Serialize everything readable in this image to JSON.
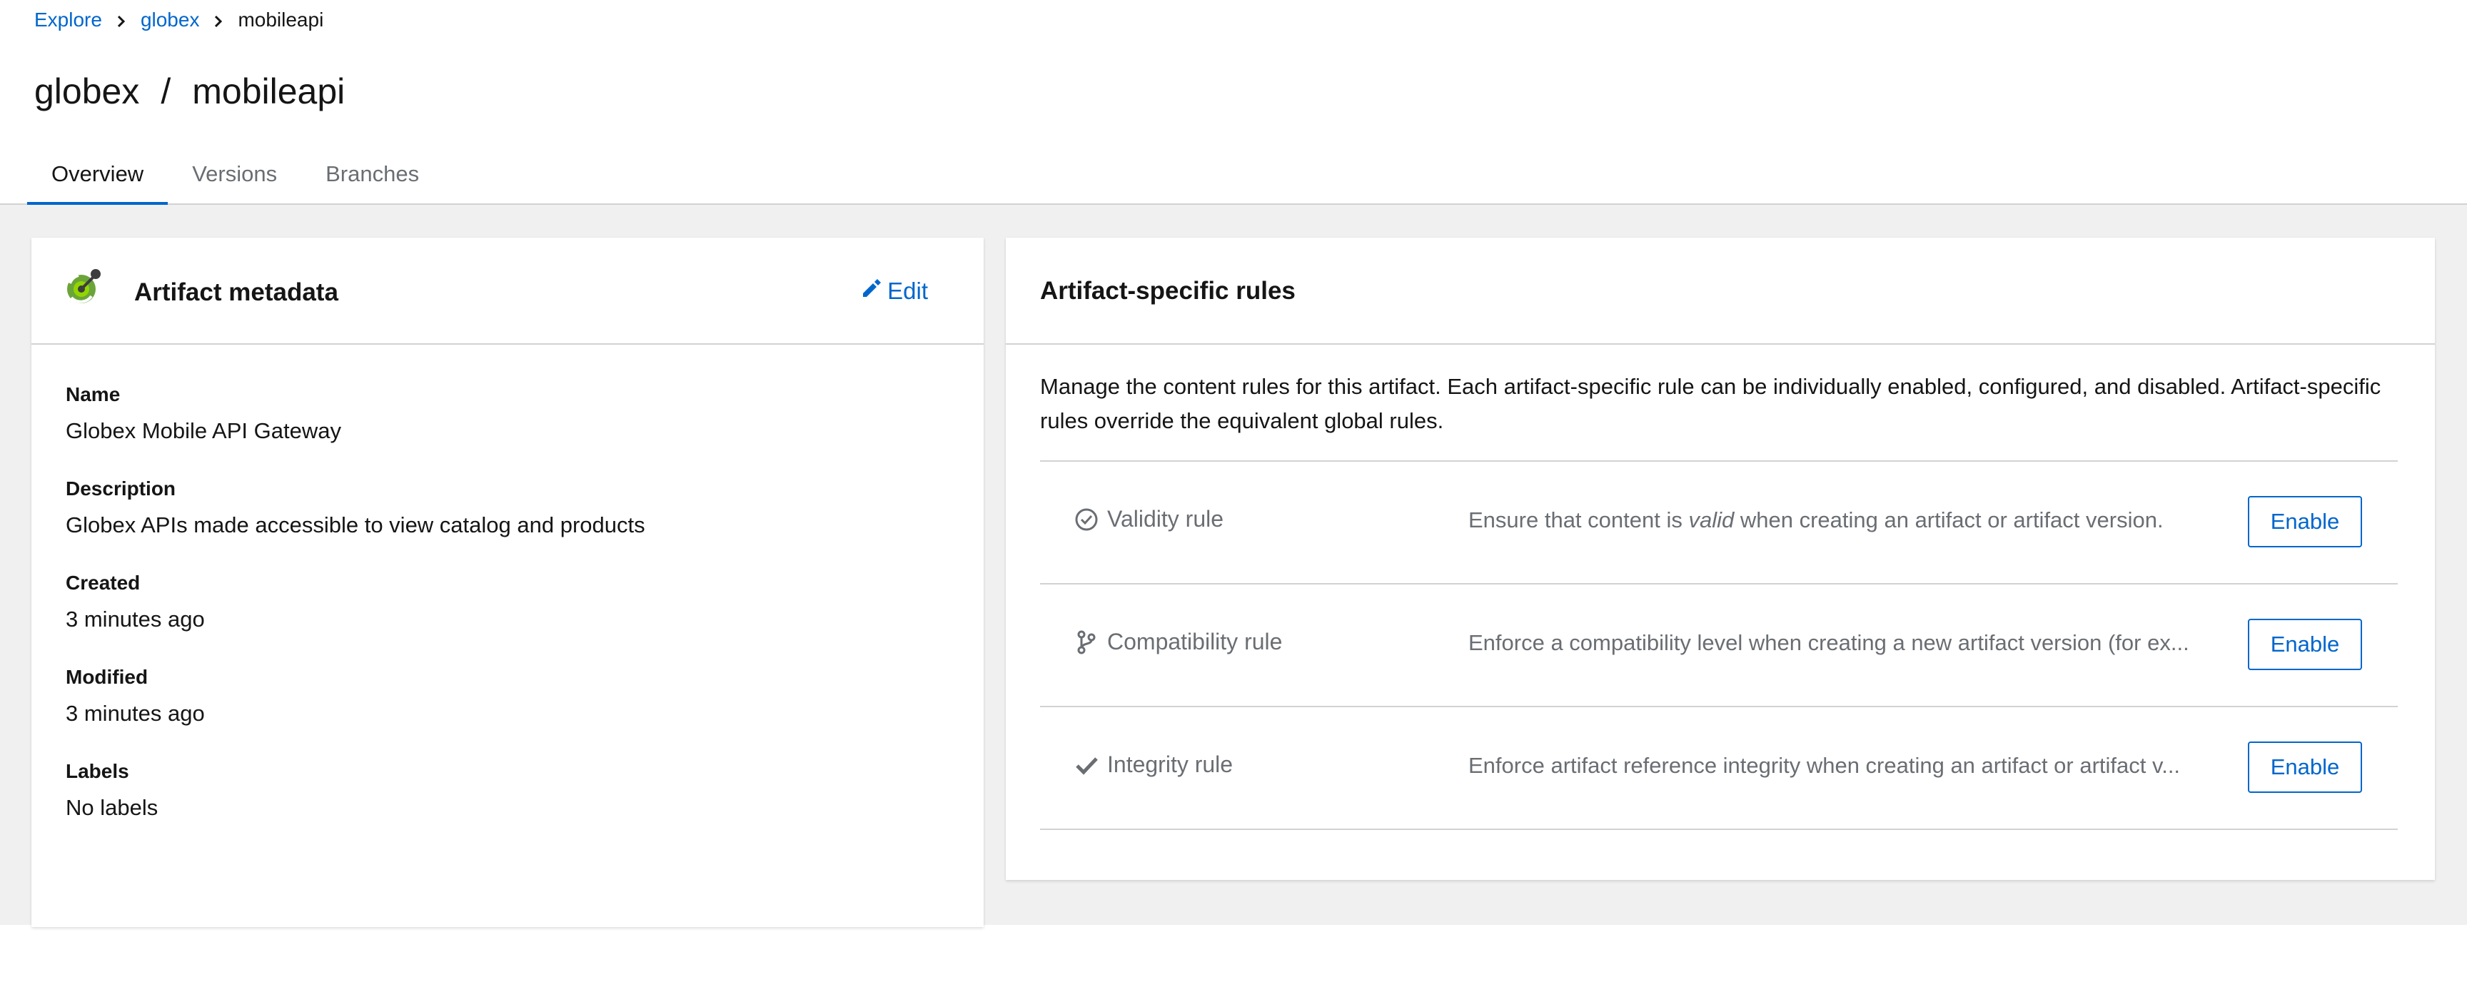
{
  "breadcrumb": {
    "items": [
      "Explore",
      "globex"
    ],
    "current": "mobileapi"
  },
  "title": {
    "group": "globex",
    "separator": "/",
    "artifact": "mobileapi"
  },
  "tabs": [
    {
      "label": "Overview",
      "active": true
    },
    {
      "label": "Versions",
      "active": false
    },
    {
      "label": "Branches",
      "active": false
    }
  ],
  "metadata_card": {
    "title": "Artifact metadata",
    "edit_label": "Edit",
    "icon": "openapi-logo-icon",
    "fields": [
      {
        "label": "Name",
        "value": "Globex Mobile API Gateway"
      },
      {
        "label": "Description",
        "value": "Globex APIs made accessible to view catalog and products"
      },
      {
        "label": "Created",
        "value": "3 minutes ago"
      },
      {
        "label": "Modified",
        "value": "3 minutes ago"
      },
      {
        "label": "Labels",
        "value": "No labels"
      }
    ]
  },
  "rules_card": {
    "title": "Artifact-specific rules",
    "description": "Manage the content rules for this artifact. Each artifact-specific rule can be individually enabled, configured, and disabled. Artifact-specific rules override the equivalent global rules.",
    "rules": [
      {
        "name": "Validity rule",
        "icon": "check-circle-icon",
        "desc_before": "Ensure that content is ",
        "desc_em": "valid",
        "desc_after": " when creating an artifact or artifact version.",
        "button": "Enable"
      },
      {
        "name": "Compatibility rule",
        "icon": "code-branch-icon",
        "desc_before": "Enforce a compatibility level when creating a new artifact version (for ex...",
        "desc_em": "",
        "desc_after": "",
        "button": "Enable"
      },
      {
        "name": "Integrity rule",
        "icon": "check-icon",
        "desc_before": "Enforce artifact reference integrity when creating an artifact or artifact v...",
        "desc_em": "",
        "desc_after": "",
        "button": "Enable"
      }
    ]
  },
  "colors": {
    "link": "#0066cc",
    "text": "#151515",
    "muted": "#6a6e73",
    "background": "#f0f0f0",
    "border": "#d2d2d2"
  }
}
